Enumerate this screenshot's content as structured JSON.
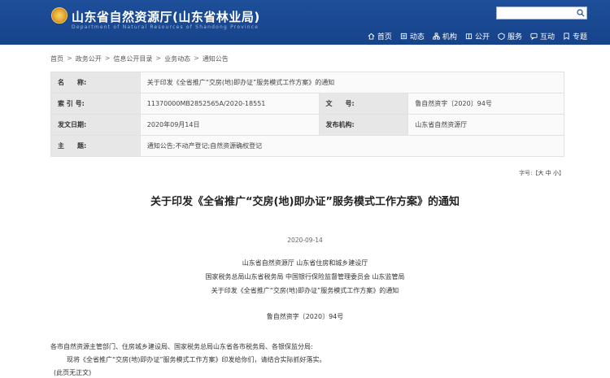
{
  "header": {
    "site_title": "山东省自然资源厅(山东省林业局)",
    "site_subtitle": "Department of Natural Resources of Shandong Province",
    "brand_color": "#1a4a94",
    "nav": [
      {
        "label": "首页",
        "icon": "home-icon"
      },
      {
        "label": "动态",
        "icon": "news-icon"
      },
      {
        "label": "机构",
        "icon": "org-icon"
      },
      {
        "label": "公开",
        "icon": "open-icon"
      },
      {
        "label": "服务",
        "icon": "service-icon"
      },
      {
        "label": "互动",
        "icon": "chat-icon"
      },
      {
        "label": "专题",
        "icon": "topic-icon"
      }
    ]
  },
  "breadcrumb": [
    "首页",
    "政务公开",
    "信息公开目录",
    "业务动态",
    "通知公告"
  ],
  "meta": {
    "name_label": "名　　称:",
    "name_value": "关于印发《全省推广“交房(地)即办证”服务模式工作方案》的通知",
    "index_label": "索 引 号:",
    "index_value": "11370000MB2852565A/2020-18551",
    "docno_label": "文　　号:",
    "docno_value": "鲁自然资字〔2020〕94号",
    "date_label": "发文日期:",
    "date_value": "2020年09月14日",
    "org_label": "发布机构:",
    "org_value": "山东省自然资源厅",
    "subject_label": "主　　题:",
    "subject_value": "通知公告;不动产登记;自然资源确权登记"
  },
  "fontsize": {
    "prefix": "字号:【",
    "large": "大",
    "medium": "中",
    "small": "小",
    "suffix": "】"
  },
  "document": {
    "title": "关于印发《全省推广“交房(地)即办证”服务模式工作方案》的通知",
    "date": "2020-09-14",
    "senders": [
      "山东省自然资源厅 山东省住房和城乡建设厅",
      "国家税务总局山东省税务局 中国银行保险监督管理委员会 山东监管局",
      "关于印发《全省推广“交房(地)即办证”服务模式工作方案》的通知"
    ],
    "doc_number": "鲁自然资字〔2020〕94号",
    "recipients": "各市自然资源主管部门、住房城乡建设局、国家税务总局山东省各市税务局、各银保监分局:",
    "body": "现将《全省推广“交房(地)即办证”服务模式工作方案》印发给你们，请结合实际抓好落实。",
    "footer_note": "(此页无正文)"
  }
}
